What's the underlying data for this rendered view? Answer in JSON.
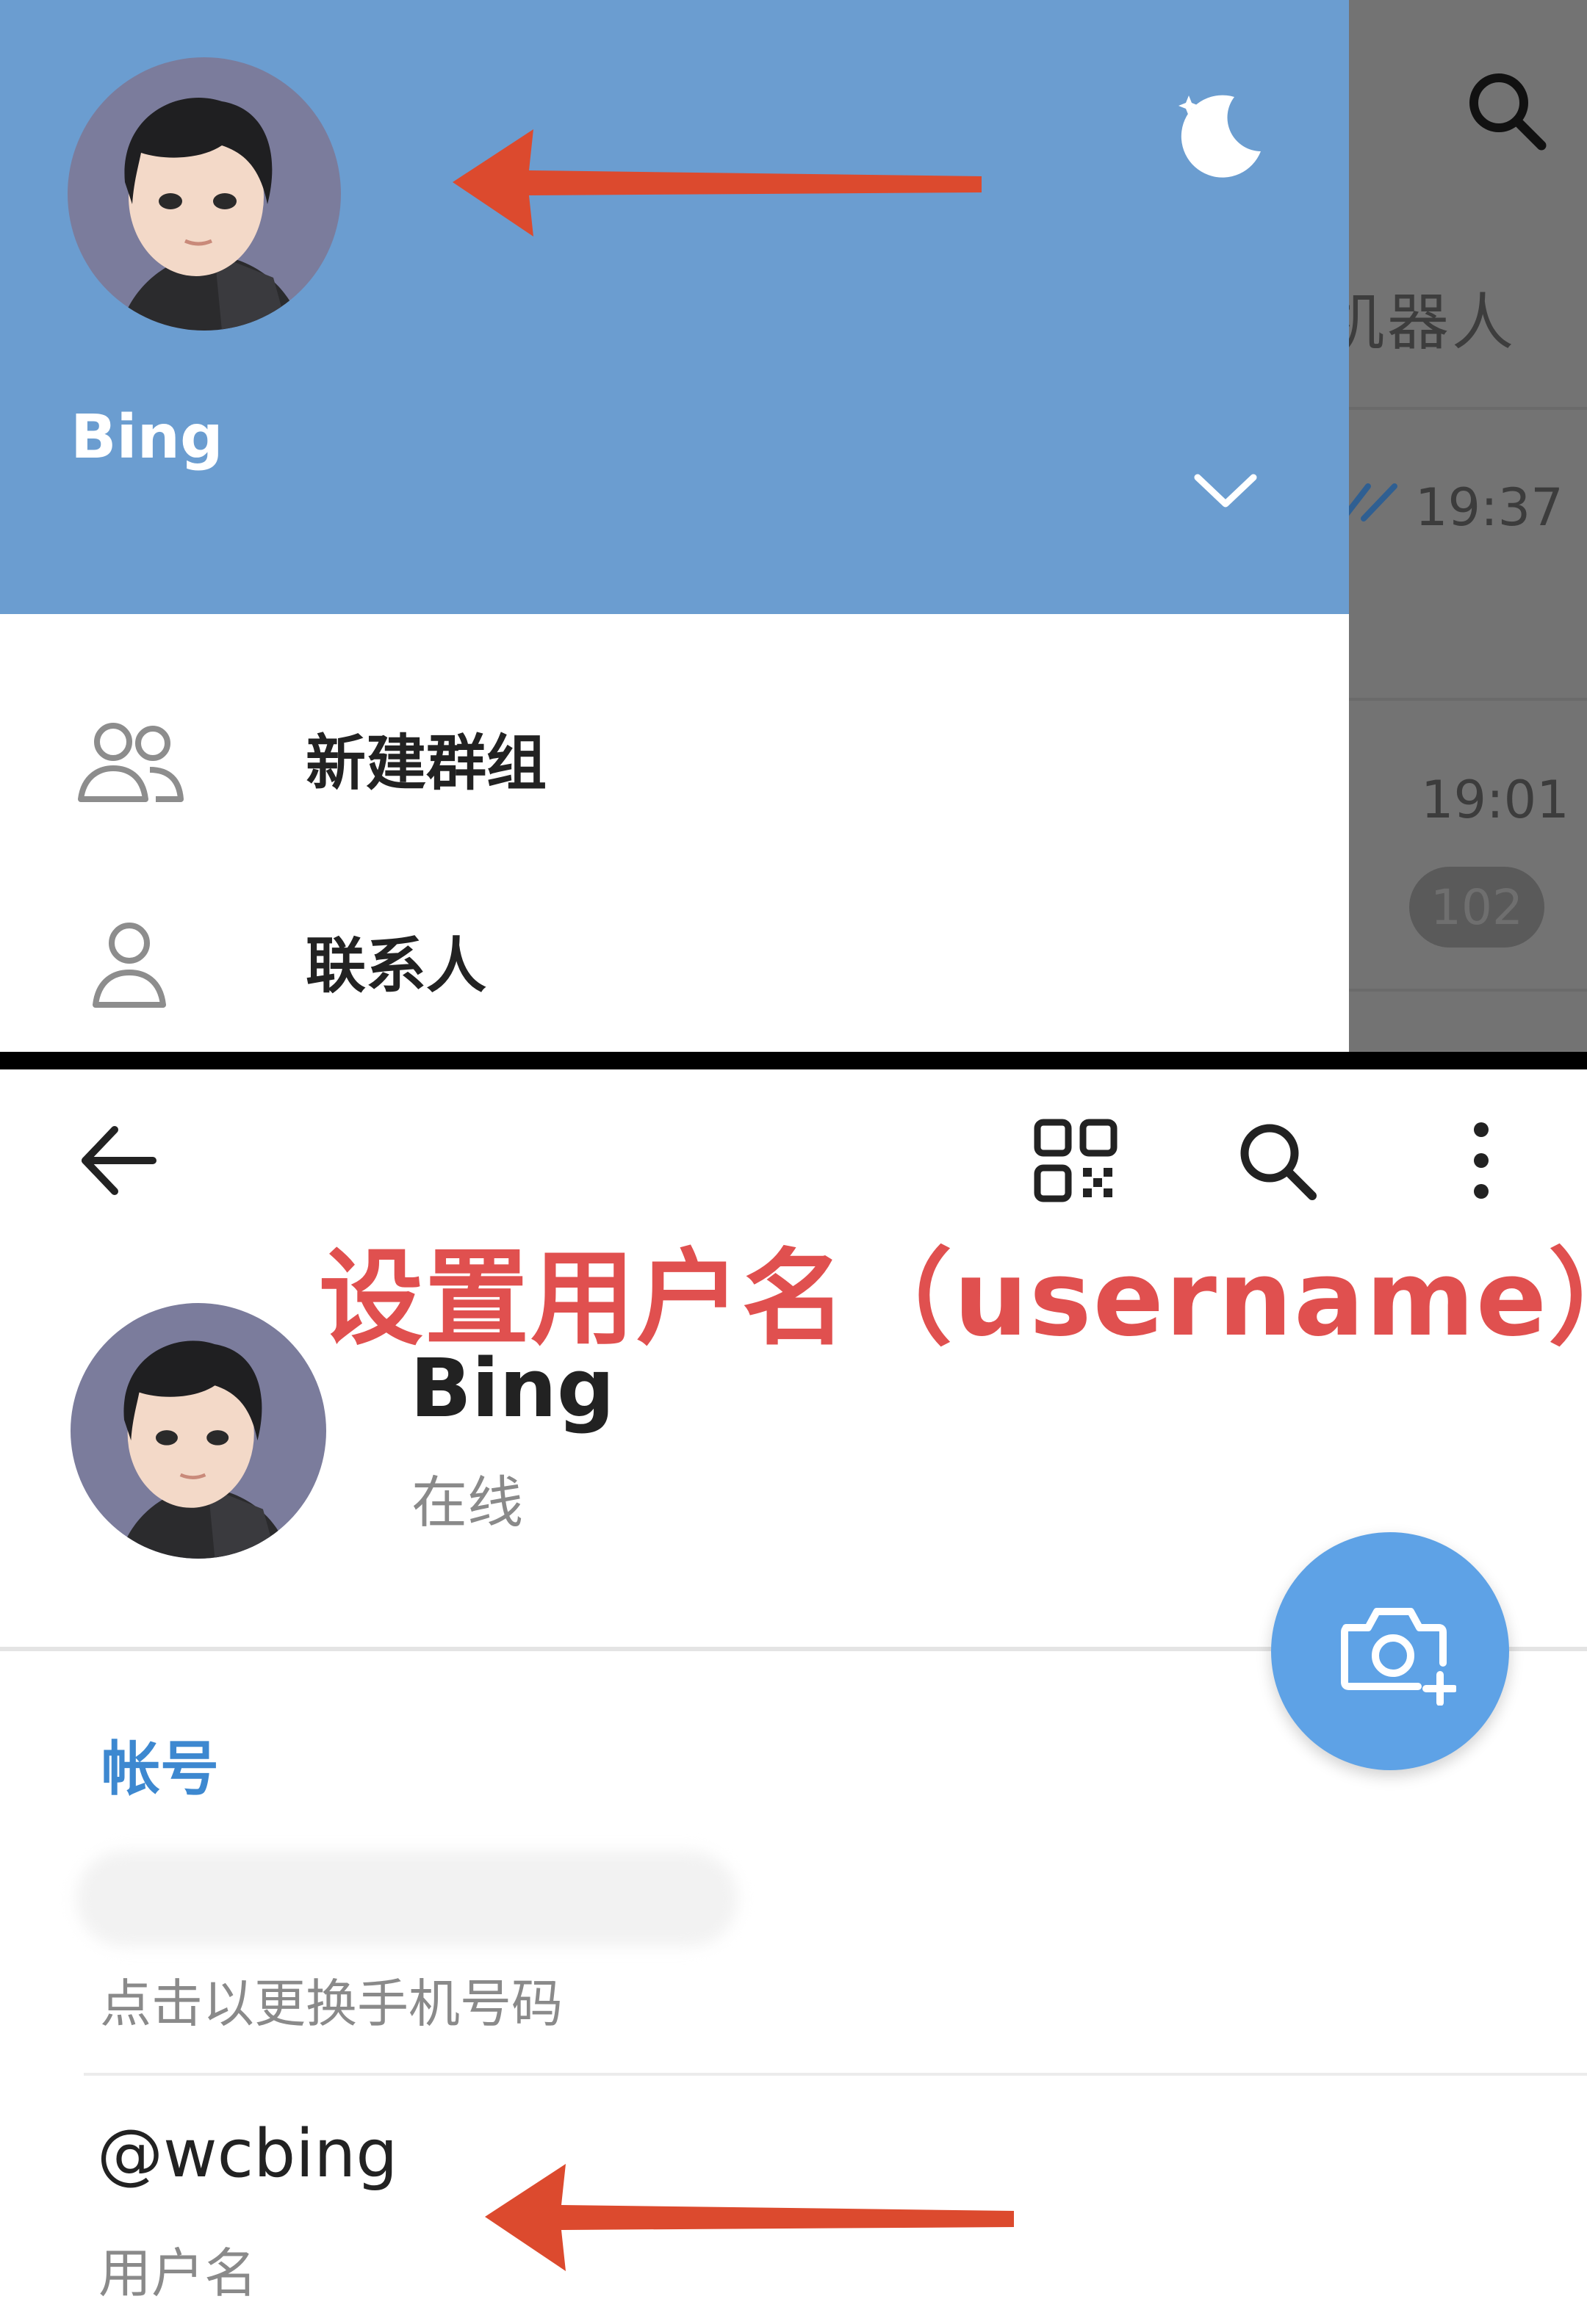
{
  "drawer": {
    "profile_name": "Bing",
    "menu_items": [
      {
        "label": "新建群组",
        "icon": "group-icon"
      },
      {
        "label": "联系人",
        "icon": "contact-icon"
      }
    ],
    "icons": {
      "night_mode": "moon-icon",
      "expand": "chevron-down-icon"
    },
    "header_color": "#6b9dd0"
  },
  "chat_list": {
    "header_partial_text": "机器人",
    "times": [
      "19:37",
      "19:01"
    ],
    "unread_badge": "102"
  },
  "profile": {
    "annotation": "设置用户名（username）",
    "name": "Bing",
    "status": "在线",
    "toolbar_icons": [
      "back-arrow-icon",
      "qr-code-icon",
      "search-icon",
      "more-vertical-icon"
    ],
    "section_title": "帐号",
    "phone_hint": "点击以更换手机号码",
    "username": "@wcbing",
    "username_label": "用户名",
    "accent_color": "#3d88d0",
    "annotation_color": "#e0504f",
    "fab_color": "#5ea2e6"
  }
}
